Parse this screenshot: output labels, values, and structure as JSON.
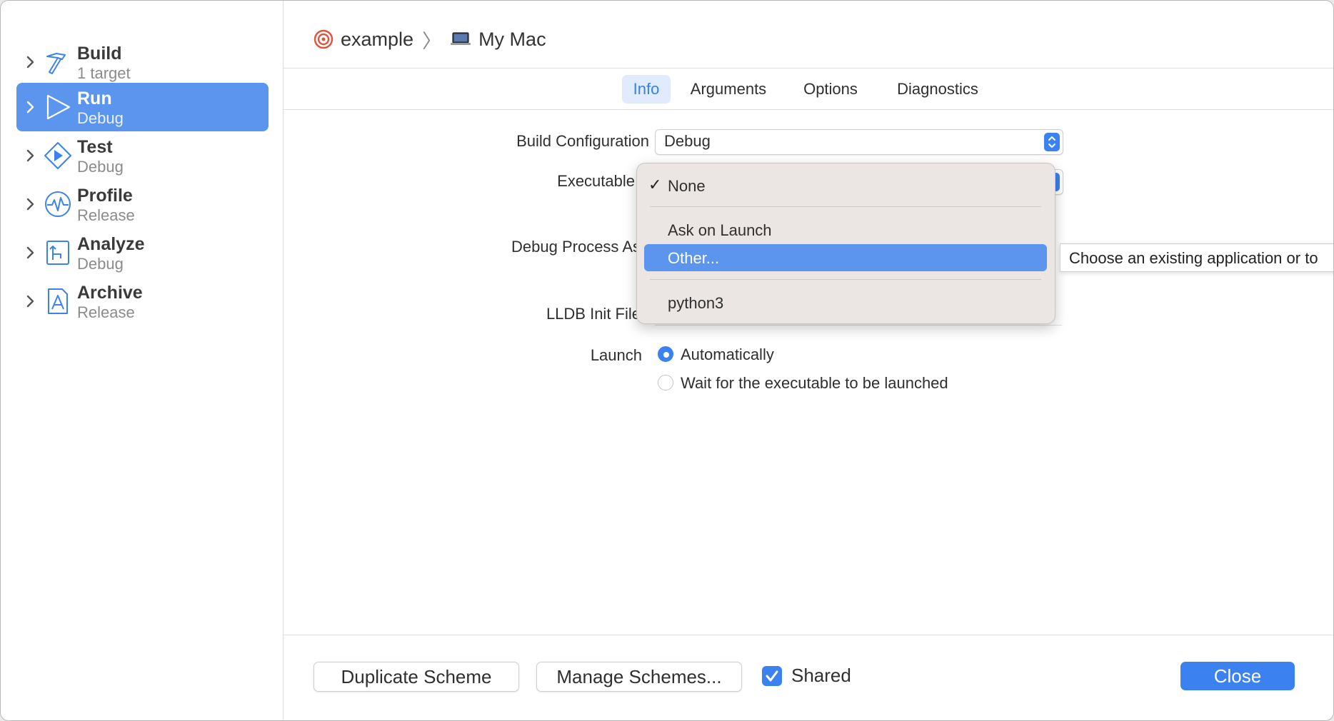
{
  "sidebar": {
    "items": [
      {
        "title": "Build",
        "subtitle": "1 target",
        "icon": "hammer-icon",
        "selected": false
      },
      {
        "title": "Run",
        "subtitle": "Debug",
        "icon": "play-triangle-icon",
        "selected": true
      },
      {
        "title": "Test",
        "subtitle": "Debug",
        "icon": "test-diamond-icon",
        "selected": false
      },
      {
        "title": "Profile",
        "subtitle": "Release",
        "icon": "waveform-icon",
        "selected": false
      },
      {
        "title": "Analyze",
        "subtitle": "Debug",
        "icon": "analyze-icon",
        "selected": false
      },
      {
        "title": "Archive",
        "subtitle": "Release",
        "icon": "archive-icon",
        "selected": false
      }
    ]
  },
  "header": {
    "scheme": "example",
    "destination": "My Mac"
  },
  "tabs": [
    {
      "label": "Info",
      "active": true
    },
    {
      "label": "Arguments",
      "active": false
    },
    {
      "label": "Options",
      "active": false
    },
    {
      "label": "Diagnostics",
      "active": false
    }
  ],
  "form": {
    "build_configuration_label": "Build Configuration",
    "build_configuration_value": "Debug",
    "executable_label": "Executable",
    "debug_process_label": "Debug Process As",
    "lldb_init_label": "LLDB Init File",
    "launch_label": "Launch",
    "launch_options": [
      {
        "label": "Automatically",
        "selected": true
      },
      {
        "label": "Wait for the executable to be launched",
        "selected": false
      }
    ]
  },
  "menu": {
    "items": [
      "None",
      "Ask on Launch",
      "Other...",
      "python3"
    ],
    "checked": "None",
    "highlighted": "Other..."
  },
  "tooltip": {
    "text": "Choose an existing application or to"
  },
  "footer": {
    "duplicate_label": "Duplicate Scheme",
    "manage_label": "Manage Schemes...",
    "shared_label": "Shared",
    "shared_checked": true,
    "close_label": "Close"
  },
  "colors": {
    "accent": "#3b82f0",
    "selection": "#5b95ee",
    "menu_bg": "#ebe6e3"
  }
}
